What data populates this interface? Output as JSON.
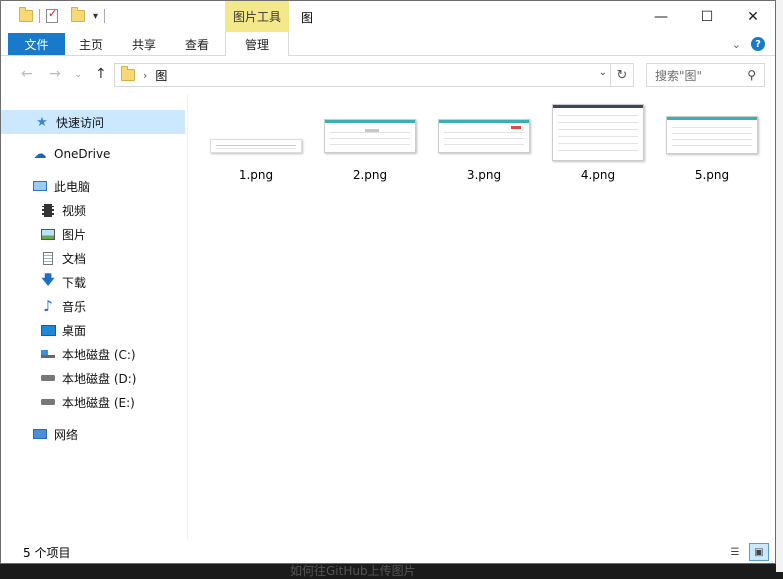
{
  "titlebar": {
    "title": "图",
    "contextual_tab_title": "图片工具",
    "minimize": "—",
    "maximize": "☐",
    "close": "✕"
  },
  "ribbon": {
    "tabs": [
      {
        "label": "文件"
      },
      {
        "label": "主页"
      },
      {
        "label": "共享"
      },
      {
        "label": "查看"
      },
      {
        "label": "管理"
      }
    ]
  },
  "navbar": {
    "back": "←",
    "forward": "→",
    "up": "↑",
    "address": "图",
    "search_placeholder": "搜索\"图\""
  },
  "sidebar": {
    "items": [
      {
        "label": "快速访问",
        "icon": "star-icon"
      },
      {
        "label": "OneDrive",
        "icon": "cloud-icon"
      },
      {
        "label": "此电脑",
        "icon": "monitor-icon"
      },
      {
        "label": "视频",
        "icon": "film-icon"
      },
      {
        "label": "图片",
        "icon": "picture-icon"
      },
      {
        "label": "文档",
        "icon": "document-icon"
      },
      {
        "label": "下载",
        "icon": "download-icon"
      },
      {
        "label": "音乐",
        "icon": "music-icon"
      },
      {
        "label": "桌面",
        "icon": "desktop-icon"
      },
      {
        "label": "本地磁盘 (C:)",
        "icon": "drive-icon"
      },
      {
        "label": "本地磁盘 (D:)",
        "icon": "drive-icon"
      },
      {
        "label": "本地磁盘 (E:)",
        "icon": "drive-icon"
      },
      {
        "label": "网络",
        "icon": "network-icon"
      }
    ]
  },
  "files": [
    {
      "name": "1.png"
    },
    {
      "name": "2.png"
    },
    {
      "name": "3.png"
    },
    {
      "name": "4.png"
    },
    {
      "name": "5.png"
    }
  ],
  "status": {
    "item_count": "5 个项目"
  },
  "background": {
    "text": "如何往GitHub上传图片"
  },
  "colors": {
    "accent": "#1979ca",
    "contextual_tab": "#f4e98a",
    "selected": "#cce8ff",
    "thumbnail_header": "#39b0b6"
  }
}
